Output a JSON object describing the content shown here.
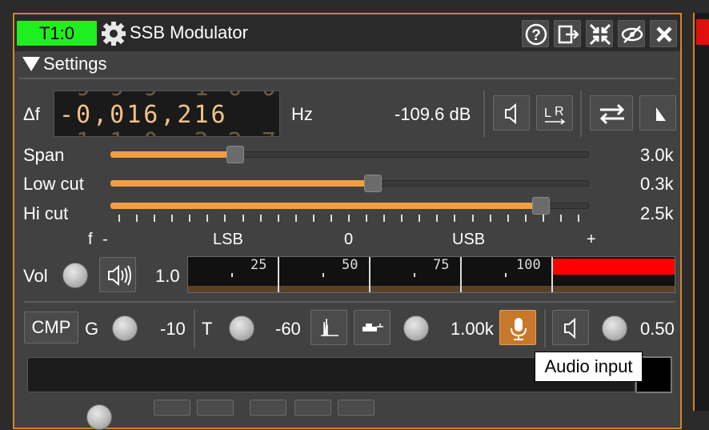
{
  "window": {
    "badge": "T1:0",
    "title": "SSB Modulator",
    "badge_color": "#1fef1f",
    "accent_color": "#d4832a",
    "title_buttons": [
      "help-icon",
      "move-to-workspace-icon",
      "shrink-icon",
      "hide-icon",
      "close-icon"
    ]
  },
  "settings": {
    "label": "Settings"
  },
  "frequency": {
    "delta_label": "Δf",
    "digits": "-0,016,216",
    "unit": "Hz",
    "power": "-109.6 dB"
  },
  "sliders": [
    {
      "label": "Span",
      "value_text": "3.0k",
      "fraction": 0.26
    },
    {
      "label": "Low cut",
      "value_text": "0.3k",
      "fraction": 0.55
    },
    {
      "label": "Hi cut",
      "value_text": "2.5k",
      "fraction": 0.9
    }
  ],
  "scale": {
    "f_label": "f",
    "minus": "-",
    "lsb": "LSB",
    "zero": "0",
    "usb": "USB",
    "plus": "+"
  },
  "volume": {
    "label": "Vol",
    "value": "1.0",
    "meter_ticks": [
      "25",
      "50",
      "75",
      "100"
    ],
    "meter_level_color": "#ff0000"
  },
  "compressor": {
    "cmp_label": "CMP",
    "g_label": "G",
    "g_value": "-10",
    "t_label": "T",
    "t_value": "-60",
    "tone_value": "1.00k",
    "audio_gain": "0.50"
  },
  "tooltip": {
    "text": "Audio input"
  },
  "colors": {
    "slider_fill": "#f0a040",
    "active_button": "#c8782a"
  }
}
